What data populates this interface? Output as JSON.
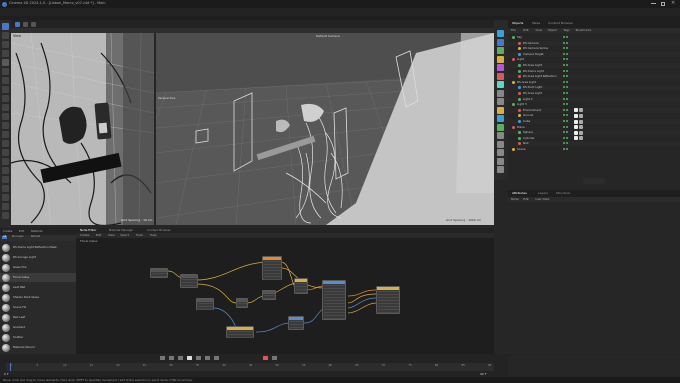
{
  "window": {
    "title": "Cinema 4D 2024.1.0 - [Lisbon_Marco_v07.c4d *] - Main",
    "controls": [
      "minimize",
      "maximize",
      "close"
    ]
  },
  "menubar": {
    "items": [
      "File",
      "Edit",
      "Create",
      "Modes",
      "Select",
      "Tools",
      "Mesh",
      "Spline",
      "Volume",
      "MoGraph",
      "Character",
      "Animate",
      "Simulate",
      "Tracker",
      "Render",
      "Extensions",
      "Window",
      "Help"
    ],
    "layouts": [
      "Startup",
      "Standard",
      "Model",
      "Sculpt",
      "UVs",
      "Paint",
      "Animate",
      "Rigging",
      "Track",
      "Script",
      "Nodes",
      "Node Space"
    ]
  },
  "viewport_left": {
    "label": "View",
    "footer": "Grid Spacing : 10 cm"
  },
  "viewport_right": {
    "label": "Perspective",
    "camera": "Default Camera",
    "footer": "Grid Spacing : 1000 cm"
  },
  "objects": {
    "tabs": [
      "Objects",
      "Takes",
      "Content Browser"
    ],
    "menu": [
      "File",
      "Edit",
      "View",
      "Object",
      "Tags",
      "Bookmarks"
    ],
    "rows": [
      "Sky",
      "RS Camera",
      "RS Camera Spline",
      "Camera Target",
      "Light",
      "RS Area Light",
      "RS Dome Light",
      "RS Area Light Reflection",
      "RS Area Light",
      "RS Point Light",
      "RS Area Light",
      "Light 2",
      "Light 3",
      "Environment",
      "Ground",
      "Cube",
      "Plane",
      "Sphere",
      "Cylinder",
      "Null",
      "Scene"
    ]
  },
  "attributes": {
    "tabs": [
      "Attributes",
      "Layers",
      "Structure"
    ],
    "menu": [
      "Mode",
      "Edit",
      "User Data"
    ]
  },
  "materials": {
    "tabs": [
      "Create",
      "Edit",
      "Material"
    ],
    "filter": [
      "All",
      "No Layer",
      "Default"
    ],
    "items": [
      "RS Dome Light Reflection Mask",
      "RS Grunge Light",
      "Glass Fire",
      "Floral Glass",
      "Leaf Wet",
      "Shader Dark Glass",
      "Scene Fill",
      "Red Leaf",
      "Gradient",
      "Scatter",
      "Material Stencil"
    ]
  },
  "node_editor": {
    "tabs": [
      "Node Editor",
      "Material Manager",
      "Content Browser"
    ],
    "menu": [
      "Create",
      "Edit",
      "View",
      "Select",
      "Tools",
      "Help"
    ],
    "material": "Floral Glass"
  },
  "timeline": {
    "current_frame": "0 F",
    "end_frame": "90 F",
    "ticks": [
      "0",
      "5",
      "10",
      "15",
      "20",
      "25",
      "30",
      "35",
      "40",
      "45",
      "50",
      "55",
      "60",
      "65",
      "70",
      "75",
      "80",
      "85",
      "90"
    ]
  },
  "status": {
    "text": "Move: Click and drag to move elements. Hold down SHIFT to quantize movement / add to the selection in point mode, CTRL to remove."
  },
  "colors": {
    "accent": "#4a78c8",
    "node_yellow": "#d8b040",
    "node_blue": "#5a8ad8",
    "node_orange": "#e08a30"
  }
}
